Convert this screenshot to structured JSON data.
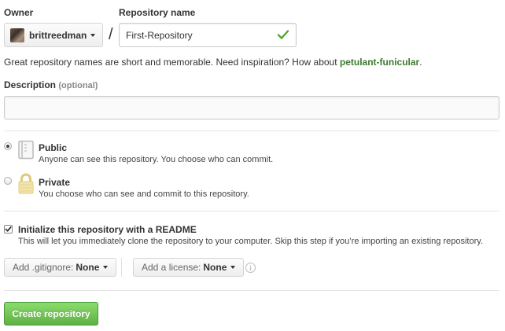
{
  "owner": {
    "label": "Owner",
    "username": "brittreedman"
  },
  "repo": {
    "label": "Repository name",
    "separator": "/",
    "value": "First-Repository",
    "valid": true
  },
  "hint": {
    "text": "Great repository names are short and memorable. Need inspiration? How about ",
    "suggestion": "petulant-funicular",
    "end": "."
  },
  "description": {
    "label": "Description",
    "optional": "(optional)",
    "value": "",
    "placeholder": ""
  },
  "visibility": {
    "selected": "public",
    "options": [
      {
        "id": "public",
        "title": "Public",
        "description": "Anyone can see this repository. You choose who can commit.",
        "icon": "repo-book-icon"
      },
      {
        "id": "private",
        "title": "Private",
        "description": "You choose who can see and commit to this repository.",
        "icon": "lock-icon"
      }
    ]
  },
  "readme": {
    "checked": true,
    "title": "Initialize this repository with a README",
    "description": "This will let you immediately clone the repository to your computer. Skip this step if you’re importing an existing repository."
  },
  "gitignore": {
    "prefix": "Add .gitignore:",
    "value": "None"
  },
  "license": {
    "prefix": "Add a license:",
    "value": "None"
  },
  "submit": {
    "label": "Create repository"
  },
  "colors": {
    "accent_green": "#60b044",
    "check_green": "#55a532",
    "private_lock": "#e9dba5"
  }
}
